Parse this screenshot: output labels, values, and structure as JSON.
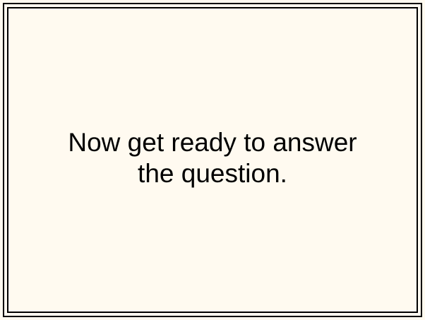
{
  "screen": {
    "background_color": "#fffaf0",
    "frame_color": "#000000",
    "message_lines": [
      "Now get ready to answer",
      "the question."
    ]
  }
}
